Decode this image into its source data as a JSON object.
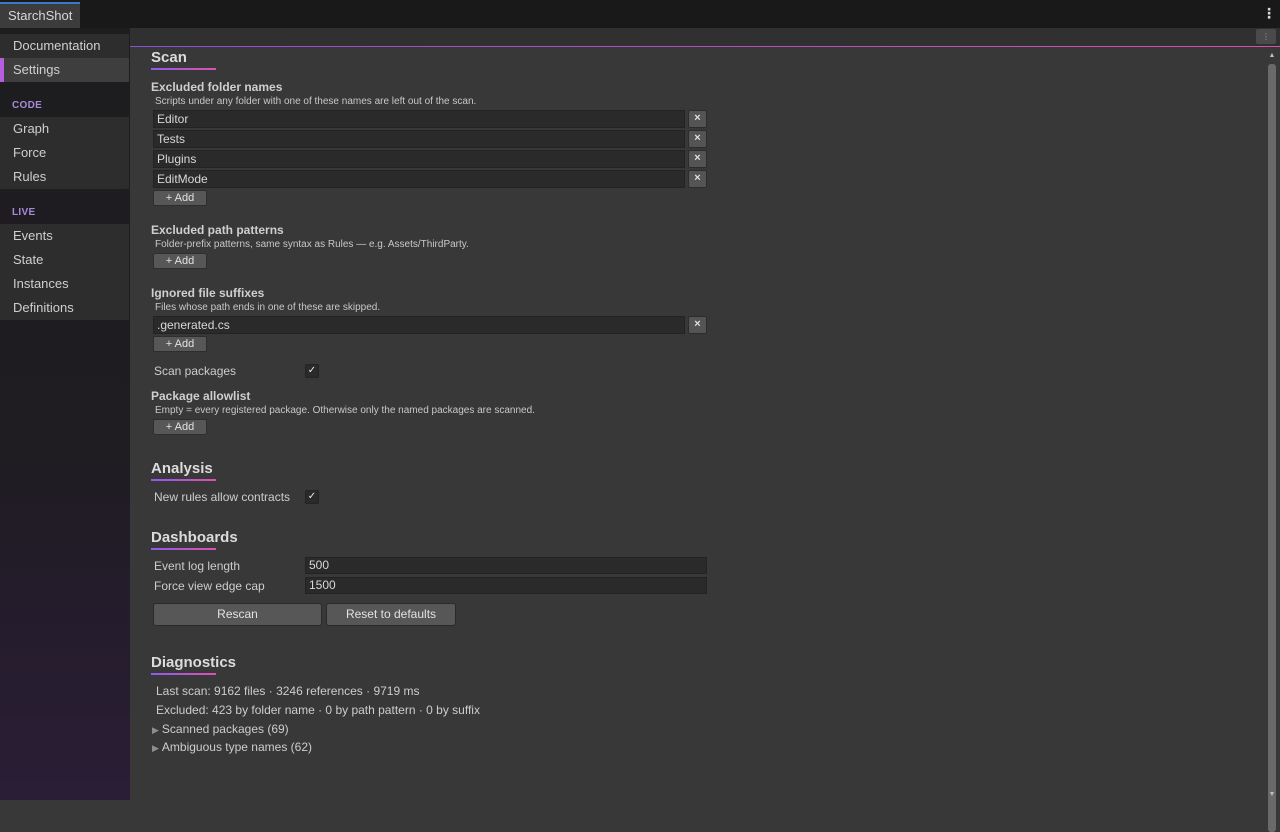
{
  "window": {
    "tab_title": "StarchShot",
    "menu_icon": "kebab-icon"
  },
  "sidebar": {
    "items_top": [
      {
        "label": "Documentation",
        "active": false
      },
      {
        "label": "Settings",
        "active": true
      }
    ],
    "group_code": {
      "title": "CODE",
      "items": [
        "Graph",
        "Force",
        "Rules"
      ]
    },
    "group_live": {
      "title": "LIVE",
      "items": [
        "Events",
        "State",
        "Instances",
        "Definitions"
      ]
    }
  },
  "scan": {
    "title": "Scan",
    "excluded_folders": {
      "label": "Excluded folder names",
      "help": "Scripts under any folder with one of these names are left out of the scan.",
      "values": [
        "Editor",
        "Tests",
        "Plugins",
        "EditMode"
      ],
      "add_label": "+ Add",
      "remove_glyph": "×"
    },
    "excluded_paths": {
      "label": "Excluded path patterns",
      "help": "Folder-prefix patterns, same syntax as Rules — e.g. Assets/ThirdParty.",
      "add_label": "+ Add"
    },
    "ignored_suffixes": {
      "label": "Ignored file suffixes",
      "help": "Files whose path ends in one of these are skipped.",
      "values": [
        ".generated.cs"
      ],
      "add_label": "+ Add",
      "remove_glyph": "×"
    },
    "scan_packages": {
      "label": "Scan packages",
      "checked": true,
      "check_glyph": "✓"
    },
    "package_allowlist": {
      "label": "Package allowlist",
      "help": "Empty = every registered package. Otherwise only the named packages are scanned.",
      "add_label": "+ Add"
    }
  },
  "analysis": {
    "title": "Analysis",
    "new_rules_allow_contracts": {
      "label": "New rules allow contracts",
      "checked": true,
      "check_glyph": "✓"
    }
  },
  "dashboards": {
    "title": "Dashboards",
    "event_log_length": {
      "label": "Event log length",
      "value": "500"
    },
    "force_view_edge_cap": {
      "label": "Force view edge cap",
      "value": "1500"
    },
    "rescan_label": "Rescan",
    "reset_label": "Reset to defaults"
  },
  "diagnostics": {
    "title": "Diagnostics",
    "last_scan": "Last scan: 9162 files · 3246 references · 9719 ms",
    "excluded": "Excluded: 423 by folder name · 0 by path pattern · 0 by suffix",
    "foldouts": [
      {
        "label": "Scanned packages (69)",
        "arrow": "▶"
      },
      {
        "label": "Ambiguous type names (62)",
        "arrow": "▶"
      }
    ]
  },
  "scrollbar": {
    "up_glyph": "▲",
    "down_glyph": "▼"
  },
  "corner_glyph": "⋮"
}
